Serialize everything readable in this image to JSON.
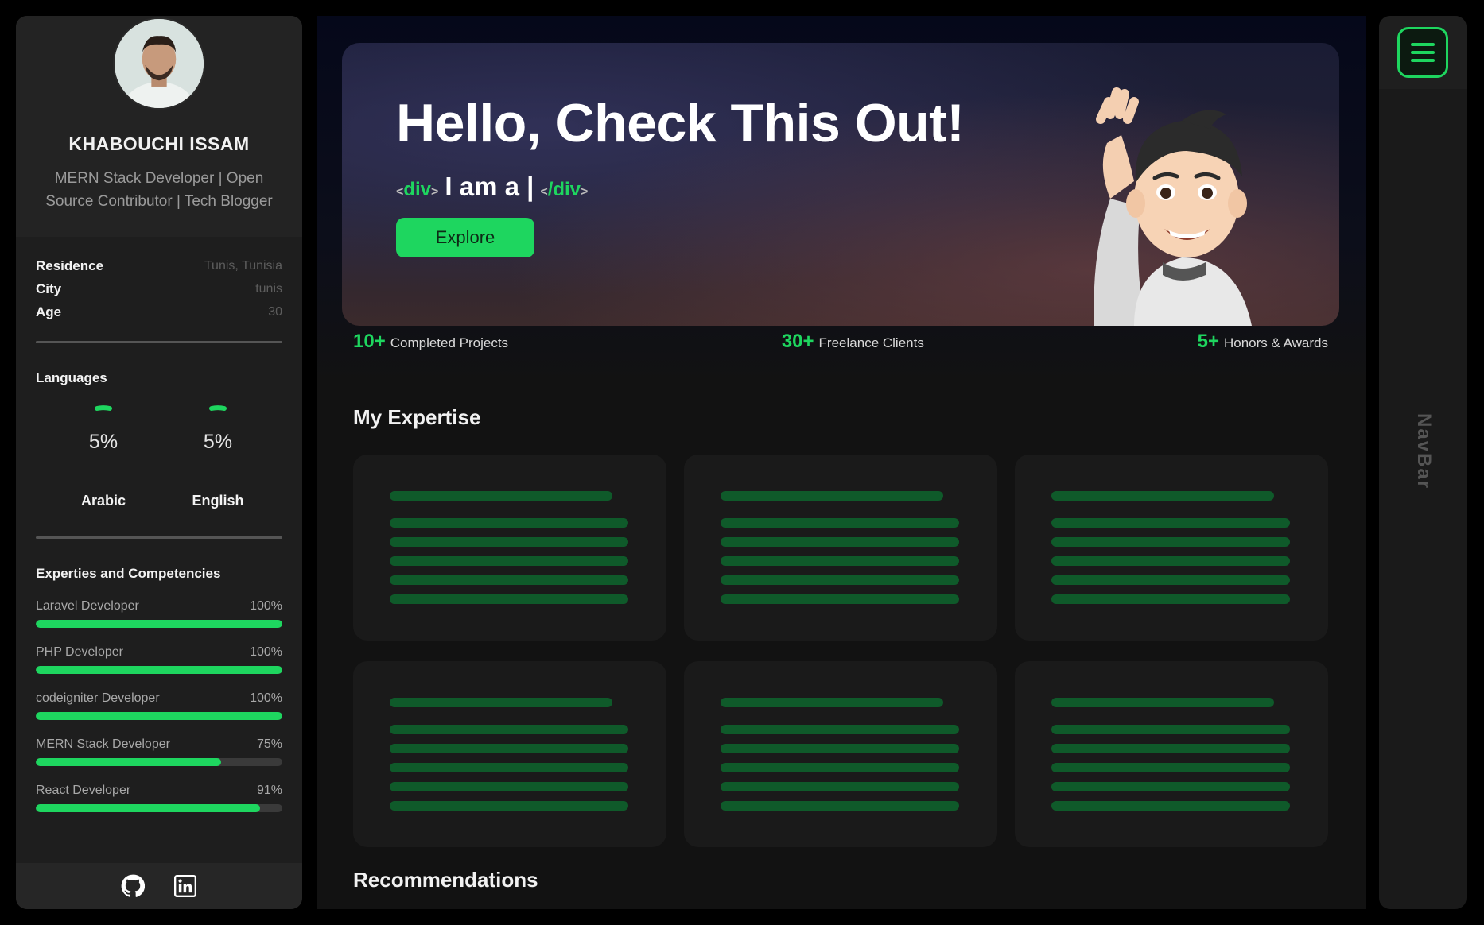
{
  "profile": {
    "name": "KHABOUCHI ISSAM",
    "role": "MERN Stack Developer | Open Source Contributor | Tech Blogger"
  },
  "info": [
    {
      "label": "Residence",
      "value": "Tunis, Tunisia"
    },
    {
      "label": "City",
      "value": "tunis"
    },
    {
      "label": "Age",
      "value": "30"
    }
  ],
  "languages": {
    "title": "Languages",
    "items": [
      {
        "name": "Arabic",
        "percent": "5%",
        "level": 0.05
      },
      {
        "name": "English",
        "percent": "5%",
        "level": 0.05
      }
    ]
  },
  "skills": {
    "title": "Experties and Competencies",
    "items": [
      {
        "name": "Laravel Developer",
        "percent": "100%",
        "level": 1.0
      },
      {
        "name": "PHP Developer",
        "percent": "100%",
        "level": 1.0
      },
      {
        "name": "codeigniter Developer",
        "percent": "100%",
        "level": 1.0
      },
      {
        "name": "MERN Stack Developer",
        "percent": "75%",
        "level": 0.75
      },
      {
        "name": "React Developer",
        "percent": "91%",
        "level": 0.91
      }
    ]
  },
  "footer_icons": [
    "github-icon",
    "linkedin-icon"
  ],
  "hero": {
    "title": "Hello, Check This Out!",
    "typed_open_tag": "div",
    "typed_text": "I am a |",
    "typed_close_tag": "/div",
    "explore_label": "Explore"
  },
  "stats": [
    {
      "number": "10+",
      "label": "Completed Projects"
    },
    {
      "number": "30+",
      "label": "Freelance Clients"
    },
    {
      "number": "5+",
      "label": "Honors & Awards"
    }
  ],
  "expertise_title": "My Expertise",
  "recommendations_title": "Recommendations",
  "navbar": {
    "label": "NavBar"
  },
  "colors": {
    "accent": "#1ed65f",
    "background": "#000000",
    "panel": "#1e1e1e"
  }
}
